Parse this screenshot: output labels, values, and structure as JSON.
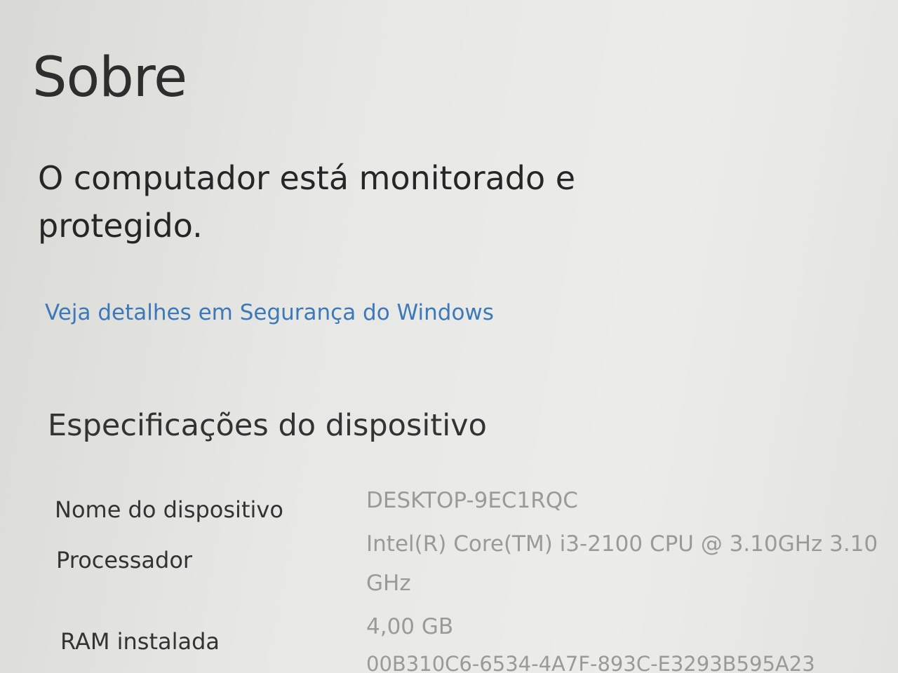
{
  "header": {
    "title": "Sobre"
  },
  "protection": {
    "status_line1": "O computador está monitorado e",
    "status_line2": "protegido.",
    "link_label": "Veja detalhes em Segurança do Windows"
  },
  "specs": {
    "section_title": "Especificações do dispositivo",
    "rows": [
      {
        "label": "Nome do dispositivo",
        "value": "DESKTOP-9EC1RQC"
      },
      {
        "label": "Processador",
        "value_line1": "Intel(R) Core(TM) i3-2100 CPU @ 3.10GHz   3.10",
        "value_line2": "GHz"
      },
      {
        "label": "RAM instalada",
        "value": "4,00 GB"
      }
    ],
    "partial_id": "00B310C6-6534-4A7F-893C-E3293B595A23"
  },
  "colors": {
    "link": "#3b79b8",
    "value_text": "#9a9a98"
  }
}
